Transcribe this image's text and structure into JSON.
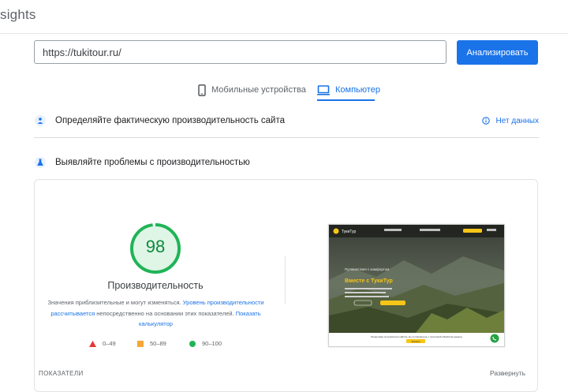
{
  "header": {
    "title": "sights"
  },
  "search": {
    "url_value": "https://tukitour.ru/",
    "analyze_label": "Анализировать"
  },
  "device_tabs": [
    {
      "label": "Мобильные устройства",
      "icon": "smartphone-icon",
      "active": false
    },
    {
      "label": "Компьютер",
      "icon": "desktop-icon",
      "active": true
    }
  ],
  "sections": {
    "field_data": {
      "title": "Определяйте фактическую производительность сайта",
      "no_data_label": "Нет данных"
    },
    "lab_data": {
      "title": "Выявляйте проблемы с производительностью"
    }
  },
  "performance": {
    "score": "98",
    "score_fraction": 0.98,
    "title": "Производительность",
    "desc_part1": "Значения приблизительные и могут изменяться.",
    "desc_link1": "Уровень производительности рассчитывается",
    "desc_part2": "непосредственно на основании этих показателей.",
    "desc_link2": "Показать калькулятор",
    "legend": [
      {
        "range": "0–49",
        "shape": "triangle",
        "color": "#e53935"
      },
      {
        "range": "50–89",
        "shape": "square",
        "color": "#f4a836"
      },
      {
        "range": "90–100",
        "shape": "circle",
        "color": "#1fb456"
      }
    ]
  },
  "screenshot": {
    "site_name": "ТукиТур",
    "tagline": "Путешествия с комфортом",
    "headline": "Вместе с ТукиТур",
    "cookie_text": "Продолжая пользоваться сайтом, вы соглашаетесь с политикой обработки данных",
    "cookie_button": "Хорошо"
  },
  "footer": {
    "metrics_label": "ПОКАЗАТЕЛИ",
    "expand_label": "Развернуть"
  },
  "colors": {
    "accent": "#1a73e8",
    "pass": "#0c8a3c",
    "gauge_track": "#dff5e6",
    "gauge_arc": "#1fb456"
  }
}
